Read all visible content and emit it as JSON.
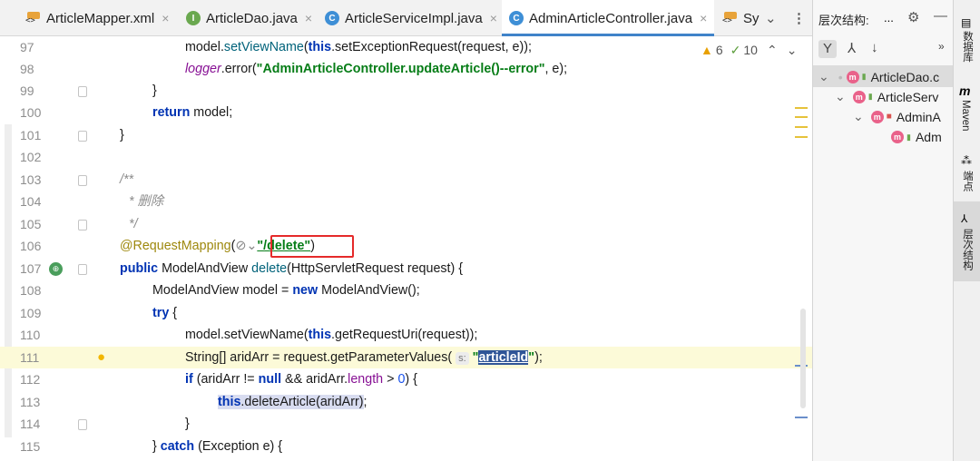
{
  "tabs": [
    {
      "label": "ArticleMapper.xml",
      "icon": "xml-file-icon"
    },
    {
      "label": "ArticleDao.java",
      "icon": "interface-icon",
      "letter": "I"
    },
    {
      "label": "ArticleServiceImpl.java",
      "icon": "class-icon",
      "letter": "C"
    },
    {
      "label": "AdminArticleController.java",
      "icon": "class-icon",
      "letter": "C"
    },
    {
      "label": "Sy",
      "icon": "xml-file-icon"
    }
  ],
  "inspection": {
    "warnings": "6",
    "checks": "10"
  },
  "editor": {
    "lines": [
      {
        "n": "97",
        "text": "model.setViewName(this.setExceptionRequest(request, e));"
      },
      {
        "n": "98",
        "text": "logger.error(\"AdminArticleController.updateArticle()--error\", e);"
      },
      {
        "n": "99",
        "text": "}"
      },
      {
        "n": "100",
        "text": "return model;"
      },
      {
        "n": "101",
        "text": "}"
      },
      {
        "n": "102",
        "text": ""
      },
      {
        "n": "103",
        "text": "/**"
      },
      {
        "n": "104",
        "text": "* 删除"
      },
      {
        "n": "105",
        "text": "*/"
      },
      {
        "n": "106",
        "text": "@RequestMapping(\"/delete\")"
      },
      {
        "n": "107",
        "text": "public ModelAndView delete(HttpServletRequest request) {"
      },
      {
        "n": "108",
        "text": "ModelAndView model = new ModelAndView();"
      },
      {
        "n": "109",
        "text": "try {"
      },
      {
        "n": "110",
        "text": "model.setViewName(this.getRequestUri(request));"
      },
      {
        "n": "111",
        "text": "String[] aridArr = request.getParameterValues(s: \"articleId\");"
      },
      {
        "n": "112",
        "text": "if (aridArr != null && aridArr.length > 0) {"
      },
      {
        "n": "113",
        "text": "this.deleteArticle(aridArr);"
      },
      {
        "n": "114",
        "text": "}"
      },
      {
        "n": "115",
        "text": "} catch (Exception e) {"
      }
    ]
  },
  "panel": {
    "title": "层次结构:",
    "more": "...",
    "tree": [
      "ArticleDao.c",
      "ArticleServ",
      "AdminA",
      "Adm"
    ]
  },
  "strip": {
    "labels": [
      "数据库",
      "Maven",
      "端点",
      "层次结构"
    ],
    "maven_glyph": "m"
  },
  "colors": {
    "accent": "#4083c9",
    "highlight": "#e52a2a",
    "current_line": "#fcfad8"
  }
}
